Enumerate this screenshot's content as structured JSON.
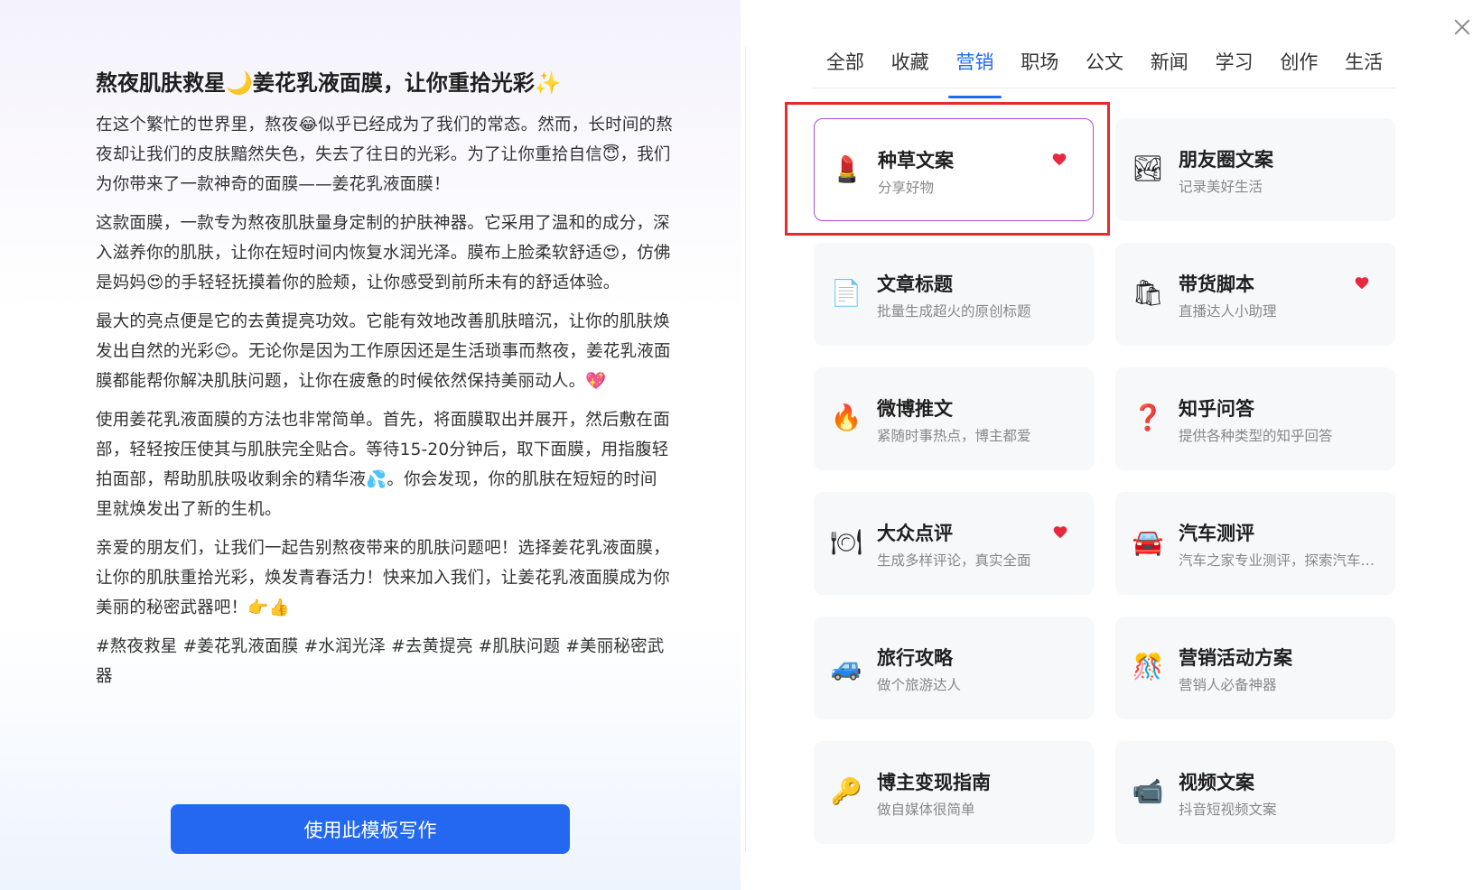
{
  "preview": {
    "title": "熬夜肌肤救星🌙姜花乳液面膜，让你重拾光彩✨",
    "paragraphs": [
      "在这个繁忙的世界里，熬夜😂似乎已经成为了我们的常态。然而，长时间的熬夜却让我们的皮肤黯然失色，失去了往日的光彩。为了让你重拾自信😇，我们为你带来了一款神奇的面膜——姜花乳液面膜！",
      "这款面膜，一款专为熬夜肌肤量身定制的护肤神器。它采用了温和的成分，深入滋养你的肌肤，让你在短时间内恢复水润光泽。膜布上脸柔软舒适😍，仿佛是妈妈😍的手轻轻抚摸着你的脸颊，让你感受到前所未有的舒适体验。",
      "最大的亮点便是它的去黄提亮功效。它能有效地改善肌肤暗沉，让你的肌肤焕发出自然的光彩😊。无论你是因为工作原因还是生活琐事而熬夜，姜花乳液面膜都能帮你解决肌肤问题，让你在疲惫的时候依然保持美丽动人。💖",
      "使用姜花乳液面膜的方法也非常简单。首先，将面膜取出并展开，然后敷在面部，轻轻按压使其与肌肤完全贴合。等待15-20分钟后，取下面膜，用指腹轻拍面部，帮助肌肤吸收剩余的精华液💦。你会发现，你的肌肤在短短的时间里就焕发出了新的生机。",
      "亲爱的朋友们，让我们一起告别熬夜带来的肌肤问题吧！选择姜花乳液面膜，让你的肌肤重拾光彩，焕发青春活力！快来加入我们，让姜花乳液面膜成为你美丽的秘密武器吧！👉👍",
      "#熬夜救星 #姜花乳液面膜 #水润光泽 #去黄提亮 #肌肤问题 #美丽秘密武器"
    ],
    "use_button": "使用此模板写作"
  },
  "tabs": [
    "全部",
    "收藏",
    "营销",
    "职场",
    "公文",
    "新闻",
    "学习",
    "创作",
    "生活"
  ],
  "active_tab": "营销",
  "cards": [
    {
      "icon": "💄",
      "icon_name": "lipstick-icon",
      "title": "种草文案",
      "sub": "分享好物",
      "fav": true
    },
    {
      "icon": "🏞",
      "icon_name": "landscape-photo-icon",
      "title": "朋友圈文案",
      "sub": "记录美好生活",
      "fav": false
    },
    {
      "icon": "📄",
      "icon_name": "document-icon",
      "title": "文章标题",
      "sub": "批量生成超火的原创标题",
      "fav": false
    },
    {
      "icon": "🛍",
      "icon_name": "shopping-bags-icon",
      "title": "带货脚本",
      "sub": "直播达人小助理",
      "fav": true
    },
    {
      "icon": "🔥",
      "icon_name": "fire-icon",
      "title": "微博推文",
      "sub": "紧随时事热点，博主都爱",
      "fav": false
    },
    {
      "icon": "❓",
      "icon_name": "question-mark-icon",
      "title": "知乎问答",
      "sub": "提供各种类型的知乎回答",
      "fav": false
    },
    {
      "icon": "🍽",
      "icon_name": "plate-cutlery-icon",
      "title": "大众点评",
      "sub": "生成多样评论，真实全面",
      "fav": true
    },
    {
      "icon": "🚘",
      "icon_name": "car-icon",
      "title": "汽车测评",
      "sub": "汽车之家专业测评，探索汽车世界",
      "fav": false
    },
    {
      "icon": "🚙",
      "icon_name": "blue-car-icon",
      "title": "旅行攻略",
      "sub": "做个旅游达人",
      "fav": false
    },
    {
      "icon": "🎊",
      "icon_name": "confetti-ball-icon",
      "title": "营销活动方案",
      "sub": "营销人必备神器",
      "fav": false
    },
    {
      "icon": "🔑",
      "icon_name": "key-icon",
      "title": "博主变现指南",
      "sub": "做自媒体很简单",
      "fav": false
    },
    {
      "icon": "📹",
      "icon_name": "video-camera-icon",
      "title": "视频文案",
      "sub": "抖音短视频文案",
      "fav": false
    }
  ],
  "colors": {
    "accent": "#2468f2",
    "fav": "#e8283f",
    "highlight": "#e52b2b",
    "selected_border": "#a94fd9"
  }
}
